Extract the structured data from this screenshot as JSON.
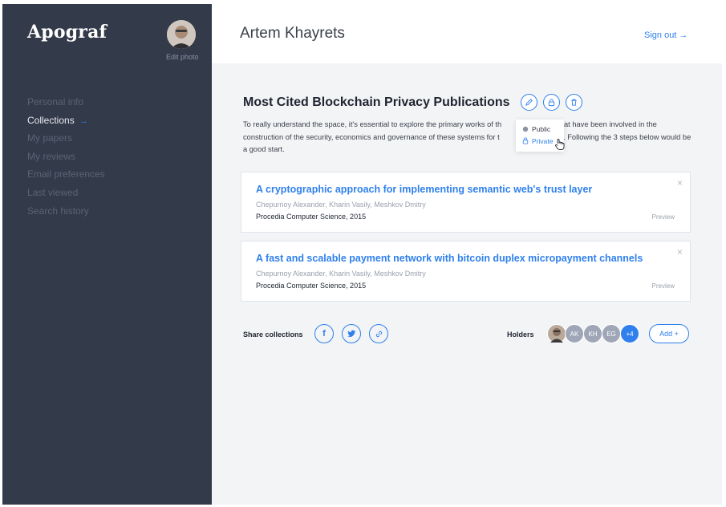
{
  "app": {
    "brand": "Apograf",
    "edit_photo": "Edit photo"
  },
  "sidebar": {
    "items": [
      {
        "label": "Personal info",
        "active": false
      },
      {
        "label": "Collections",
        "active": true,
        "arrow": "→"
      },
      {
        "label": "My papers",
        "active": false
      },
      {
        "label": "My reviews",
        "active": false
      },
      {
        "label": "Email preferences",
        "active": false
      },
      {
        "label": "Last viewed",
        "active": false
      },
      {
        "label": "Search history",
        "active": false
      }
    ]
  },
  "header": {
    "user_name": "Artem Khayrets",
    "sign_out": "Sign out  →"
  },
  "collection": {
    "title": "Most Cited Blockchain Privacy Publications",
    "description_parts": [
      "To really understand the space, it's essential to explore the primary works of th",
      "tors that have been involved in the construction of the security, economics and governance of these systems for t",
      "l years. Following the 3 steps below would be a good start."
    ],
    "actions": [
      "edit-icon",
      "lock-icon",
      "trash-icon"
    ]
  },
  "visibility_menu": {
    "options": [
      {
        "label": "Public",
        "icon": "globe-icon",
        "selected": false
      },
      {
        "label": "Private",
        "icon": "lock-icon",
        "selected": true
      }
    ]
  },
  "papers": [
    {
      "title": "A cryptographic approach for implementing semantic web's trust layer",
      "authors": "Chepurnoy Alexander, Kharin Vasily, Meshkov Dmitry",
      "journal": "Procedia Computer Science, 2015",
      "preview": "Preview",
      "close": "×"
    },
    {
      "title": "A fast and scalable payment network with bitcoin duplex micropayment channels",
      "authors": "Chepurnoy Alexander, Kharin Vasily, Meshkov Dmitry",
      "journal": "Procedia Computer Science, 2015",
      "preview": "Preview",
      "close": "×"
    }
  ],
  "share": {
    "label": "Share collections",
    "buttons": [
      {
        "glyph": "f",
        "icon": "facebook-icon"
      },
      {
        "glyph": "t",
        "icon": "twitter-icon"
      },
      {
        "glyph": "",
        "icon": "link-icon"
      }
    ]
  },
  "holders": {
    "label": "Holders",
    "avatars": [
      {
        "initials": "",
        "color": "#b9a99a"
      },
      {
        "initials": "AK",
        "color": "#9ea6b7"
      },
      {
        "initials": "KH",
        "color": "#9ea6b7"
      },
      {
        "initials": "EG",
        "color": "#9ea6b7"
      },
      {
        "initials": "+4",
        "color": "#2f80ed"
      }
    ],
    "add_label": "Add +"
  },
  "colors": {
    "accent": "#2f80ed",
    "sidebar": "#333a49",
    "muted_nav": "#5b6375"
  }
}
